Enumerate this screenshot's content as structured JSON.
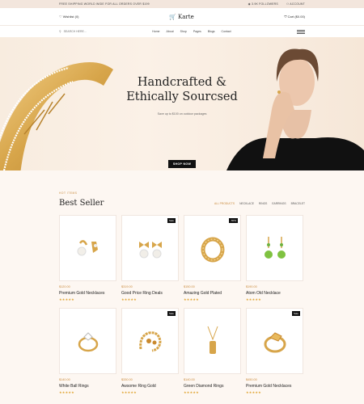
{
  "topbar": {
    "shipping": "FREE SHIPPING WORLD WIDE FOR ALL ORDERS OVER $199",
    "followers": "3.9K FOLLOWERS",
    "account": "ACCOUNT"
  },
  "header": {
    "wishlist": "Wishlist (0)",
    "brand": "Karte",
    "cart": "Cart ($0.00)"
  },
  "nav": {
    "search_placeholder": "SEARCH HERE...",
    "links": [
      "Home",
      "About",
      "Shop",
      "Pages",
      "Blogs",
      "Contact"
    ]
  },
  "hero": {
    "title_line1": "Handcrafted &",
    "title_line2": "Ethically Sourcsed",
    "subtitle": "Save up to $100 on outdoor packages",
    "button": "SHOP NOW"
  },
  "bestseller": {
    "eyebrow": "HOT ITEMS",
    "title": "Best Seller",
    "filters": [
      "ALL PRODUCTS",
      "NECKLACE",
      "RINGS",
      "EARRINGS",
      "BRACELET"
    ],
    "products": [
      {
        "price": "$120.00",
        "name": "Premium Gold Necklaces",
        "badge": "",
        "icon": "earring-icon",
        "stars": "★★★★★"
      },
      {
        "price": "$319.00",
        "name": "Good Price Ring Deals",
        "badge": "Sale",
        "icon": "bow-earring-icon",
        "stars": "★★★★★"
      },
      {
        "price": "$150.00",
        "name": "Amazing Gold Plated",
        "badge": "-50%",
        "icon": "ring-icon",
        "stars": "★★★★★"
      },
      {
        "price": "$190.00",
        "name": "Atom Old Necklace",
        "badge": "",
        "icon": "drop-earring-icon",
        "stars": "★★★★★"
      },
      {
        "price": "$140.00",
        "name": "White Ball Rings",
        "badge": "",
        "icon": "diamond-ring-icon",
        "stars": "★★★★★"
      },
      {
        "price": "$330.00",
        "name": "Awsome Ring Gold",
        "badge": "Sale",
        "icon": "bracelet-icon",
        "stars": "★★★★★"
      },
      {
        "price": "$140.00",
        "name": "Green Diamond Rings",
        "badge": "",
        "icon": "pendant-icon",
        "stars": "★★★★★"
      },
      {
        "price": "$450.00",
        "name": "Premium Gold Necklaces",
        "badge": "Sale",
        "icon": "gem-ring-icon",
        "stars": "★★★★★"
      }
    ]
  },
  "colors": {
    "accent": "#c98a3b",
    "hero_bg": "#f8ecdf",
    "gold": "#d7a54a"
  }
}
